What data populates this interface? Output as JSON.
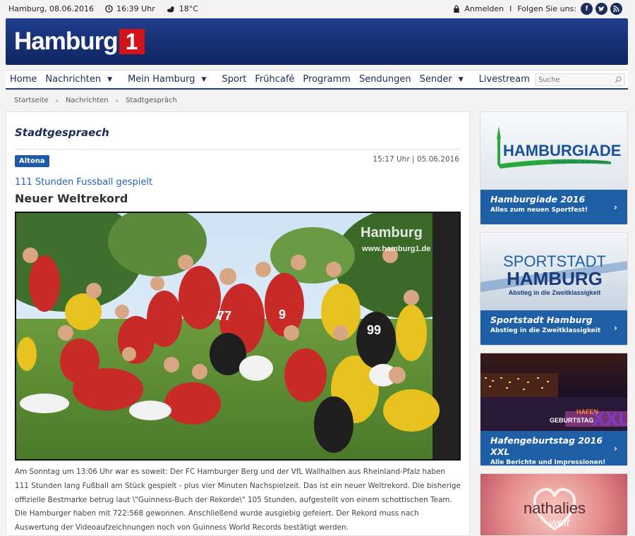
{
  "topbar": {
    "location_date": "Hamburg, 08.06.2016",
    "time": "16:39 Uhr",
    "weather": "18°C",
    "login_label": "Anmelden",
    "separator": "I",
    "follow_label": "Folgen Sie uns:",
    "social": [
      "f",
      "t",
      "rss"
    ]
  },
  "header": {
    "logo_word": "Hamburg",
    "logo_number": "1",
    "brand_red": "#d3131a",
    "brand_blue": "#1b3c83"
  },
  "nav": {
    "items": [
      {
        "label": "Home",
        "dropdown": false
      },
      {
        "label": "Nachrichten",
        "dropdown": true
      },
      {
        "label": "Mein Hamburg",
        "dropdown": true
      },
      {
        "label": "Sport",
        "dropdown": false
      },
      {
        "label": "Frühcafé",
        "dropdown": false
      },
      {
        "label": "Programm",
        "dropdown": false
      },
      {
        "label": "Sendungen",
        "dropdown": false
      },
      {
        "label": "Sender",
        "dropdown": true
      },
      {
        "label": "Livestream",
        "dropdown": false
      }
    ],
    "search_placeholder": "Suche"
  },
  "breadcrumb": [
    "Startseite",
    "Nachrichten",
    "Stadtgespräch"
  ],
  "main": {
    "section_title": "Stadtgespraech",
    "tag": "Altona",
    "date": "15:17 Uhr | 05.06.2016",
    "subtitle": "111 Stunden Fussball gespielt",
    "headline": "Neuer Weltrekord",
    "photo_watermark": "Hamburg",
    "photo_url_text": "www.hamburg1.de",
    "jersey_numbers": [
      "77",
      "9",
      "99"
    ],
    "article": "Am Sonntag um 13:06 Uhr war es soweit: Der FC Hamburger Berg und der VfL Wallhalben aus Rheinland-Pfalz haben 111 Stunden lang Fußball am Stück gespielt - plus vier Minuten Nachspielzeit. Das ist ein neuer Weltrekord. Die bisherige offizielle Bestmarke betrug laut \\\"Guinness-Buch der Rekorde\\\" 105 Stunden, aufgestellt von einem schottischen Team. Die Hamburger haben mit 722:568 gewonnen. Anschließend wurde ausgiebig gefeiert. Der Rekord muss nach Auswertung der Videoaufzeichnungen noch von Guinness World Records bestätigt werden."
  },
  "sidebar": [
    {
      "image_title": "HAMBURGIADE",
      "image_tagline": "Company Games, Health & Nutrition",
      "title": "Hamburgiade 2016",
      "subtitle": "Alles zum neuen Sportfest!"
    },
    {
      "image_line1": "SPORTSTADT",
      "image_line2": "HAMBURG",
      "image_tagline": "Abstieg in die Zweitklassigkeit",
      "title": "Sportstadt Hamburg",
      "subtitle": "Abstieg in die Zweitklassigkeit"
    },
    {
      "image_line1": "HAFEN",
      "image_line2": "GEBURTSTAG",
      "image_line3": "XXL",
      "title": "Hafengeburtstag 2016 XXL",
      "subtitle": "Alle Berichte und Impressionen!"
    },
    {
      "image_line1": "nathalies",
      "image_line2": "welt"
    }
  ]
}
